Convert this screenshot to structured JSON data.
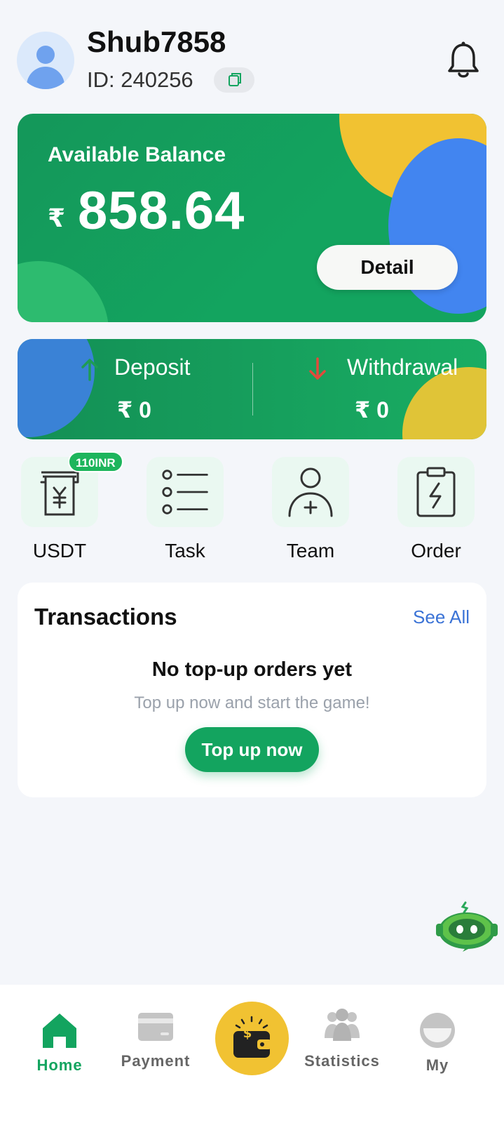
{
  "header": {
    "username": "Shub7858",
    "id_text": "ID:  240256"
  },
  "balance": {
    "label": "Available Balance",
    "currency": "₹",
    "amount": "858.64",
    "detail_button": "Detail"
  },
  "flows": {
    "deposit_label": "Deposit",
    "deposit_value": "₹ 0",
    "withdrawal_label": "Withdrawal",
    "withdrawal_value": "₹ 0"
  },
  "quick_actions": [
    {
      "label": "USDT",
      "badge": "110INR",
      "icon": "yuan-receipt-icon"
    },
    {
      "label": "Task",
      "icon": "list-icon"
    },
    {
      "label": "Team",
      "icon": "add-user-icon"
    },
    {
      "label": "Order",
      "icon": "clipboard-bolt-icon"
    }
  ],
  "transactions": {
    "title": "Transactions",
    "see_all": "See All",
    "empty_title": "No top-up orders yet",
    "empty_subtitle": "Top up now and start the game!",
    "topup_button": "Top up now"
  },
  "bottom_nav": {
    "items": [
      {
        "label": "Home",
        "icon": "home-icon",
        "active": true
      },
      {
        "label": "Payment",
        "icon": "card-icon"
      },
      {
        "label": "",
        "icon": "wallet-icon"
      },
      {
        "label": "Statistics",
        "icon": "people-icon"
      },
      {
        "label": "My",
        "icon": "profile-icon"
      }
    ]
  },
  "colors": {
    "brand_green": "#13a45f",
    "accent_yellow": "#f1c232",
    "accent_blue": "#4285f0",
    "link_blue": "#3b73d6",
    "withdraw_arrow": "#e24a3b"
  }
}
